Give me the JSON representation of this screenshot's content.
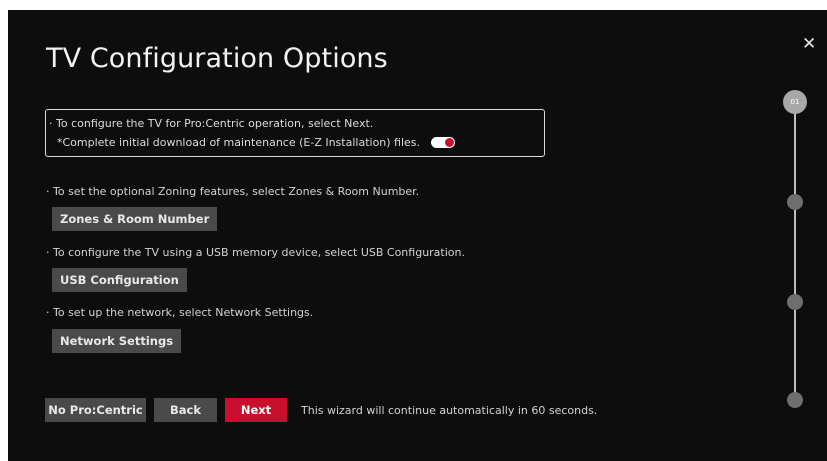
{
  "title": "TV Configuration Options",
  "close_glyph": "✕",
  "notice": {
    "line1": "· To configure the TV for Pro:Centric operation, select Next.",
    "line2": "*Complete initial download of maintenance (E-Z Installation) files.",
    "toggle_on": true
  },
  "zones": {
    "desc": "· To set the optional Zoning features, select Zones & Room Number.",
    "button": "Zones & Room Number"
  },
  "usb": {
    "desc": "· To configure the TV using a USB memory device, select USB Configuration.",
    "button": "USB Configuration"
  },
  "network": {
    "desc": "· To set up the network, select Network Settings.",
    "button": "Network Settings"
  },
  "footer": {
    "no_procentric": "No Pro:Centric",
    "back": "Back",
    "next": "Next",
    "auto_message": "This wizard will continue automatically in 60 seconds."
  },
  "stepper": {
    "current_label": "01",
    "current_step": 1,
    "total_steps": 4
  },
  "colors": {
    "background": "#0d0d0d",
    "accent": "#c8102e",
    "button": "#4a4a4a"
  }
}
